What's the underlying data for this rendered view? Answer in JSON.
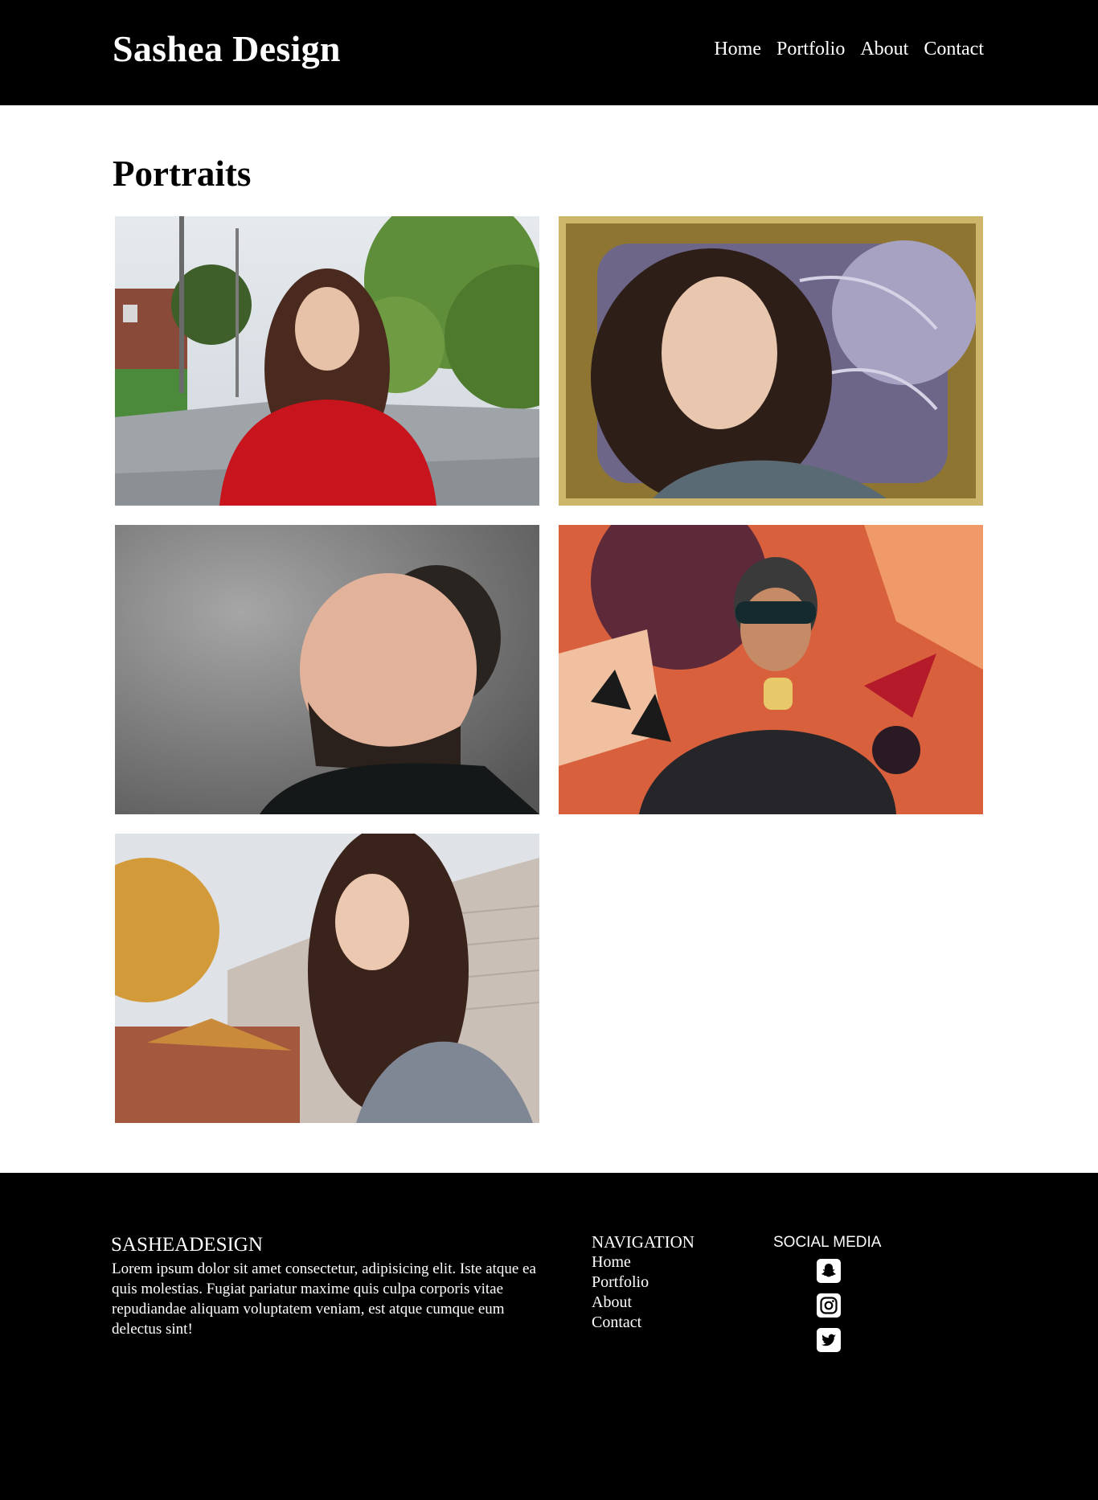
{
  "header": {
    "logo": "Sashea Design",
    "nav": [
      {
        "label": "Home"
      },
      {
        "label": "Portfolio"
      },
      {
        "label": "About"
      },
      {
        "label": "Contact"
      }
    ]
  },
  "main": {
    "title": "Portraits",
    "photos": [
      {
        "alt": "portrait-woman-red-sweater-street"
      },
      {
        "alt": "portrait-woman-gold-frame"
      },
      {
        "alt": "portrait-man-turtleneck-grey"
      },
      {
        "alt": "portrait-man-sunglasses-mural"
      },
      {
        "alt": "portrait-woman-denim-jacket"
      }
    ]
  },
  "footer": {
    "brand": "SASHEADESIGN",
    "text": "Lorem ipsum dolor sit amet consectetur, adipisicing elit. Iste atque ea quis molestias. Fugiat pariatur maxime quis culpa corporis vitae repudiandae aliquam voluptatem veniam, est atque cumque eum delectus sint!",
    "nav_title": "NAVIGATION",
    "nav_links": [
      {
        "label": "Home"
      },
      {
        "label": "Portfolio"
      },
      {
        "label": "About"
      },
      {
        "label": "Contact"
      }
    ],
    "social_title": "SOCIAL MEDIA",
    "social_icons": [
      "snapchat-icon",
      "instagram-icon",
      "twitter-icon"
    ]
  }
}
